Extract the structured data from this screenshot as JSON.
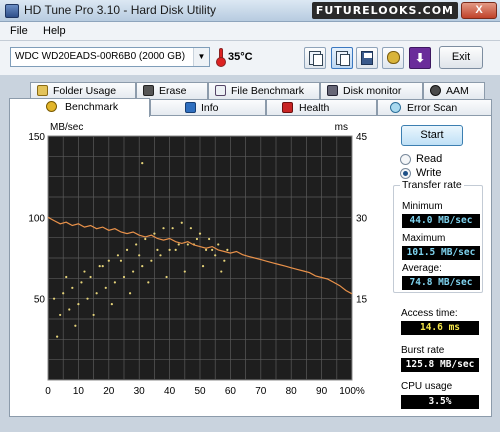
{
  "window": {
    "title": "HD Tune Pro 3.10 - Hard Disk Utility",
    "watermark": "FUTURELOOKS.COM",
    "close_label": "X"
  },
  "menu": [
    "File",
    "Help"
  ],
  "toolbar": {
    "drive": "WDC WD20EADS-00R6B0 (2000 GB)",
    "temperature": "35°C",
    "exit_label": "Exit",
    "icons": [
      "copy-info-icon",
      "copy-screenshot-icon",
      "save-icon",
      "options-icon",
      "download-icon"
    ]
  },
  "tabs_row1": [
    {
      "label": "Folder Usage",
      "icon": "folder-icon"
    },
    {
      "label": "Erase",
      "icon": "trash-icon"
    },
    {
      "label": "File Benchmark",
      "icon": "file-benchmark-icon"
    },
    {
      "label": "Disk monitor",
      "icon": "disk-monitor-icon"
    },
    {
      "label": "AAM",
      "icon": "speaker-icon"
    }
  ],
  "tabs_row2": [
    {
      "label": "Benchmark",
      "icon": "benchmark-icon",
      "selected": true
    },
    {
      "label": "Info",
      "icon": "info-icon"
    },
    {
      "label": "Health",
      "icon": "health-cross-icon"
    },
    {
      "label": "Error Scan",
      "icon": "magnifier-icon"
    }
  ],
  "controls": {
    "start_label": "Start",
    "read_label": "Read",
    "write_label": "Write",
    "selected_mode": "Write"
  },
  "transfer_rate": {
    "title": "Transfer rate",
    "minimum_label": "Minimum",
    "minimum_value": "44.0 MB/sec",
    "maximum_label": "Maximum",
    "maximum_value": "101.5 MB/sec",
    "average_label": "Average:",
    "average_value": "74.8 MB/sec"
  },
  "access_time": {
    "label": "Access time:",
    "value": "14.6 ms"
  },
  "burst_rate": {
    "label": "Burst rate",
    "value": "125.8 MB/sec"
  },
  "cpu_usage": {
    "label": "CPU usage",
    "value": "3.5%"
  },
  "colors": {
    "plot_bg": "#1e1e1e",
    "grid": "#5a5a5a",
    "transfer_line": "#e8914a",
    "access_points": "#e6d47a"
  },
  "chart_data": {
    "type": "line",
    "ylabel": "MB/sec",
    "y2label": "ms",
    "ylim": [
      0,
      150
    ],
    "y2lim": [
      0,
      45
    ],
    "xlim": [
      0,
      100
    ],
    "y_ticks": [
      "150",
      "100",
      "50"
    ],
    "y2_ticks": [
      "45",
      "30",
      "15"
    ],
    "x_ticks": [
      "0",
      "10",
      "20",
      "30",
      "40",
      "50",
      "60",
      "70",
      "80",
      "90",
      "100%"
    ],
    "grid": true,
    "series": [
      {
        "x": [
          0,
          2,
          4,
          6,
          8,
          10,
          12,
          14,
          16,
          18,
          20,
          22,
          24,
          26,
          28,
          30,
          32,
          34,
          36,
          38,
          40,
          42,
          44,
          46,
          48,
          50,
          52,
          54,
          56,
          58,
          60,
          62,
          64,
          66,
          68,
          70,
          72,
          74,
          76,
          78,
          80,
          82,
          84,
          86,
          88,
          90,
          92,
          94,
          96,
          98,
          100
        ],
        "values": [
          100,
          98,
          96,
          97,
          95,
          96,
          94,
          95,
          93,
          94,
          92,
          93,
          91,
          90,
          91,
          89,
          88,
          89,
          87,
          86,
          87,
          85,
          84,
          85,
          83,
          82,
          81,
          82,
          80,
          79,
          78,
          79,
          77,
          76,
          75,
          74,
          73,
          72,
          71,
          70,
          69,
          68,
          67,
          66,
          64,
          63,
          62,
          60,
          58,
          55,
          53
        ]
      },
      {
        "x": [
          2,
          5,
          8,
          11,
          14,
          17,
          20,
          23,
          26,
          29,
          32,
          35,
          38,
          41,
          44,
          47,
          50,
          53,
          56,
          59,
          4,
          7,
          10,
          13,
          16,
          19,
          22,
          25,
          28,
          31,
          34,
          37,
          40,
          43,
          46,
          49,
          52,
          55,
          58,
          3,
          9,
          15,
          21,
          27,
          33,
          39,
          45,
          51,
          57,
          6,
          12,
          18,
          24,
          30,
          36,
          42,
          48,
          54,
          31
        ],
        "values": [
          15,
          16,
          17,
          18,
          19,
          21,
          22,
          23,
          24,
          25,
          26,
          27,
          28,
          28,
          29,
          28,
          27,
          26,
          25,
          24,
          12,
          13,
          14,
          15,
          16,
          17,
          18,
          19,
          20,
          21,
          22,
          23,
          24,
          25,
          25,
          26,
          24,
          23,
          22,
          8,
          10,
          12,
          14,
          16,
          18,
          19,
          20,
          21,
          20,
          19,
          20,
          21,
          22,
          23,
          24,
          24,
          25,
          24,
          40
        ]
      }
    ]
  }
}
